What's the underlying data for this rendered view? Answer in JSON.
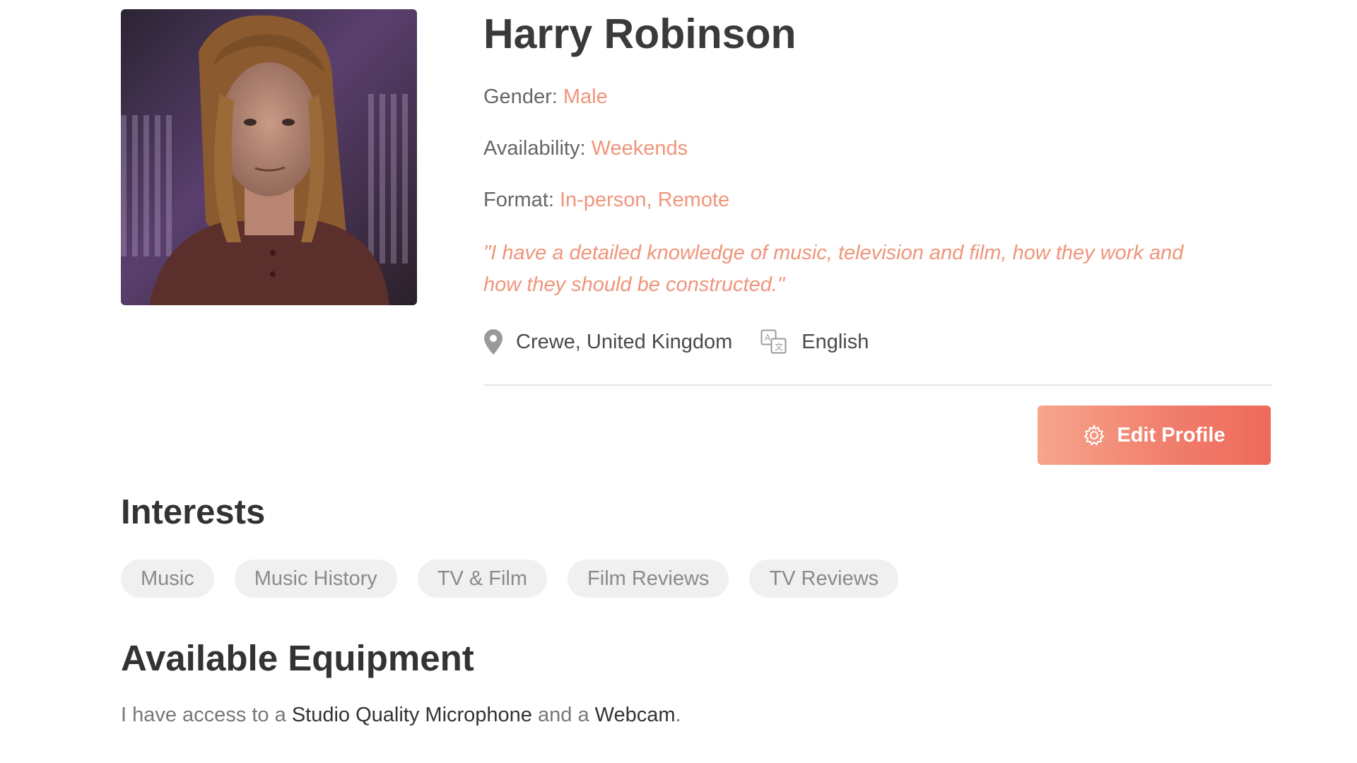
{
  "profile": {
    "name": "Harry Robinson",
    "gender_label": "Gender:",
    "gender_value": "Male",
    "availability_label": "Availability:",
    "availability_value": "Weekends",
    "format_label": "Format:",
    "format_value": "In-person, Remote",
    "quote_line1": "\"I have a  detailed knowledge of music, television and film, how they work and",
    "quote_line2": "how they should be constructed.\"",
    "location": "Crewe, United Kingdom",
    "language": "English",
    "location_icon": "map-pin-icon",
    "language_icon": "translate-icon"
  },
  "actions": {
    "edit_profile_label": "Edit Profile",
    "edit_profile_icon": "gear-icon"
  },
  "interests": {
    "title": "Interests",
    "tags": [
      "Music",
      "Music History",
      "TV & Film",
      "Film Reviews",
      "TV Reviews"
    ]
  },
  "equipment": {
    "title": "Available Equipment",
    "text_prefix": "I have access to a ",
    "item1": "Studio Quality Microphone",
    "text_middle": " and a ",
    "item2": "Webcam",
    "text_suffix": "."
  },
  "colors": {
    "accent": "#f0957a",
    "button_start": "#f7a58c",
    "button_end": "#ee6a5a",
    "tag_bg": "#f0f0f0",
    "heading": "#333333"
  }
}
